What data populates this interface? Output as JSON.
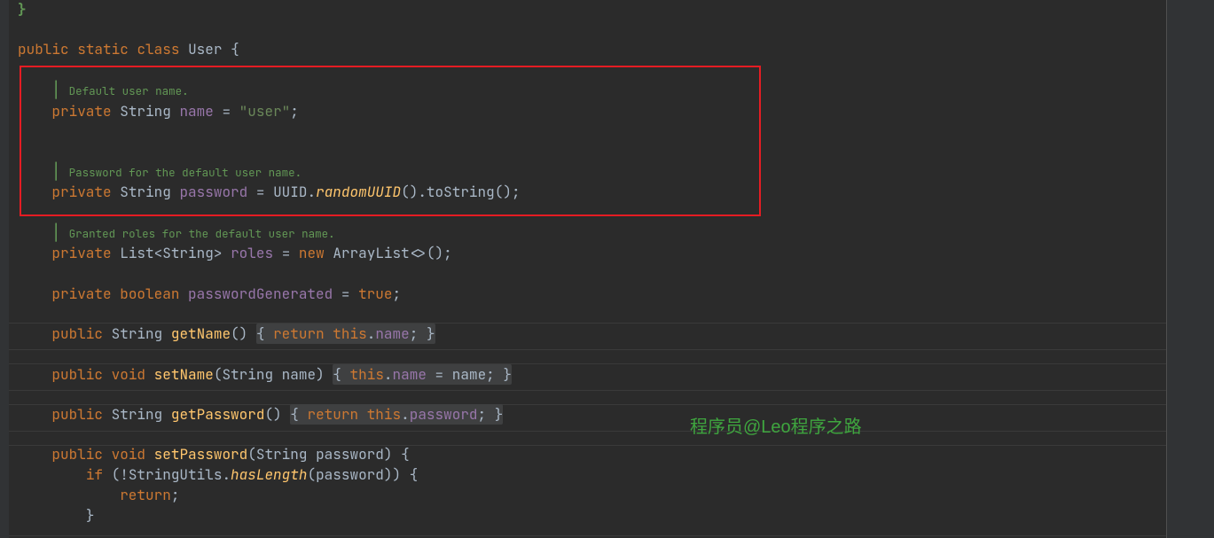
{
  "code": {
    "brace0": "}",
    "classDecl": {
      "public": "public",
      "static": "static",
      "class": "class",
      "name": "User",
      "open": "{"
    },
    "doc1": "Default user name.",
    "field1": {
      "private": "private",
      "type": "String",
      "name": "name",
      "eq": "=",
      "value": "\"user\"",
      "semi": ";"
    },
    "doc2": "Password for the default user name.",
    "field2": {
      "private": "private",
      "type": "String",
      "name": "password",
      "eq": "=",
      "uuid": "UUID",
      "dot1": ".",
      "rand": "randomUUID",
      "paren1": "()",
      "dot2": ".",
      "tostr": "toString",
      "paren2": "()",
      "semi": ";"
    },
    "doc3": "Granted roles for the default user name.",
    "field3": "private List<String> roles = new ArrayList<>();",
    "field4": "private boolean passwordGenerated = true;",
    "getName": "public String getName() { return this.name; }",
    "setName": "public void setName(String name) { this.name = name; }",
    "getPassword": "public String getPassword() { return this.password; }",
    "setPassword_sig": "public void setPassword(String password) {",
    "setPassword_if": "if (!StringUtils.hasLength(password)) {",
    "setPassword_ret": "return;",
    "setPassword_cb": "}"
  },
  "watermark": "程序员@Leo程序之路",
  "tokens": {
    "private": "private",
    "public": "public",
    "void": "void",
    "boolean": "boolean",
    "return": "return",
    "this": "this",
    "new": "new",
    "if": "if",
    "true": "true"
  }
}
